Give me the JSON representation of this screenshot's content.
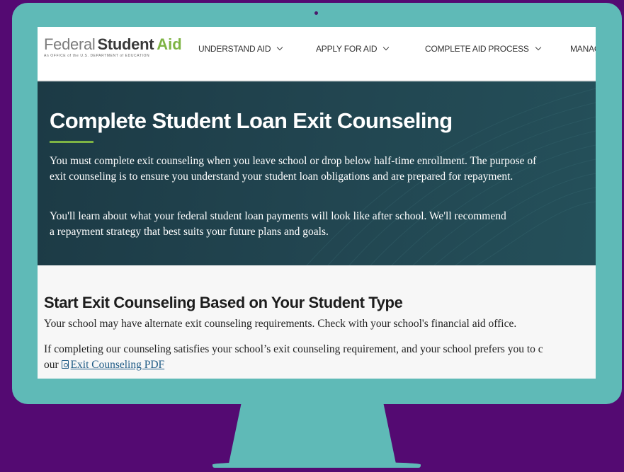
{
  "brand": {
    "logo_federal": "Federal",
    "logo_student": "Student",
    "logo_aid": "Aid",
    "logo_subtitle": "An OFFICE of the U.S. DEPARTMENT of EDUCATION"
  },
  "nav": {
    "items": [
      {
        "label": "UNDERSTAND AID",
        "icon": "chevron-down-icon"
      },
      {
        "label": "APPLY FOR AID",
        "icon": "chevron-down-icon"
      },
      {
        "label": "COMPLETE AID PROCESS",
        "icon": "chevron-down-icon"
      },
      {
        "label": "MANAG"
      }
    ]
  },
  "hero": {
    "title": "Complete Student Loan Exit Counseling",
    "paragraph1": "You must complete exit counseling when you leave school or drop below half-time enrollment. The purpose of exit counseling is to ensure you understand your student loan obligations and are prepared for repayment.",
    "paragraph2": "You'll learn about what your federal student loan payments will look like after school. We'll recommend a repayment strategy that best suits your future plans and goals."
  },
  "section": {
    "title": "Start Exit Counseling Based on Your Student Type",
    "paragraph1": "Your school may have alternate exit counseling requirements. Check with your school's financial aid office.",
    "paragraph2": "If completing our counseling satisfies your school’s exit counseling requirement, and your school prefers you to c",
    "paragraph3_prefix": "our ",
    "pdf_link_label": "Exit Counseling PDF",
    "pdf_icon": "pdf-file-icon"
  },
  "colors": {
    "background": "#540a72",
    "monitor": "#5fbab7",
    "hero_bg": "#224651",
    "accent_green": "#7eb444",
    "link": "#1f5b86"
  }
}
